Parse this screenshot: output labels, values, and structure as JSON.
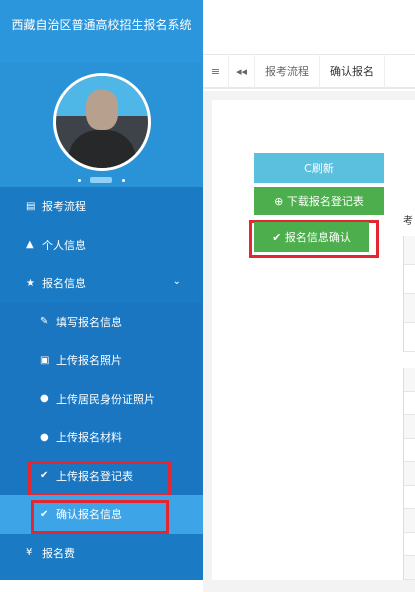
{
  "sidebar": {
    "system_title": "西藏自治区普通高校招生报名系统",
    "items": [
      {
        "label": "报考流程",
        "icon": "list-icon",
        "glyph": "▤",
        "level": "top"
      },
      {
        "label": "个人信息",
        "icon": "user-icon",
        "glyph": "▲",
        "level": "top"
      },
      {
        "label": "报名信息",
        "icon": "star-icon",
        "glyph": "★",
        "level": "top",
        "expanded": true,
        "chevron": "⌄"
      },
      {
        "label": "填写报名信息",
        "icon": "edit-icon",
        "glyph": "✎",
        "level": "sub"
      },
      {
        "label": "上传报名照片",
        "icon": "image-icon",
        "glyph": "▣",
        "level": "sub"
      },
      {
        "label": "上传居民身份证照片",
        "icon": "upload-circle-icon",
        "glyph": "●",
        "level": "sub"
      },
      {
        "label": "上传报名材料",
        "icon": "upload-circle-icon",
        "glyph": "●",
        "level": "sub"
      },
      {
        "label": "上传报名登记表",
        "icon": "check-icon",
        "glyph": "✔",
        "level": "sub",
        "highlighted": true
      },
      {
        "label": "确认报名信息",
        "icon": "check-icon",
        "glyph": "✔",
        "level": "sub",
        "active": true,
        "highlighted": true
      },
      {
        "label": "报名费",
        "icon": "yen-icon",
        "glyph": "¥",
        "level": "top"
      }
    ]
  },
  "tabbar": {
    "menu_glyph": "≡",
    "back_glyph": "◂◂",
    "tabs": [
      {
        "label": "报考流程"
      },
      {
        "label": "确认报名"
      }
    ]
  },
  "actions": {
    "refresh_label": "C刷新",
    "download_label": "⊕ 下载报名登记表",
    "confirm_label": "✔ 报名信息确认"
  },
  "content": {
    "side_label": "考"
  },
  "colors": {
    "sidebar_bg": "#1a7bc4",
    "sidebar_active": "#3ea4e8",
    "highlight_border": "#e3262f",
    "refresh_btn": "#5bc0de",
    "success_btn": "#4cae4c"
  }
}
